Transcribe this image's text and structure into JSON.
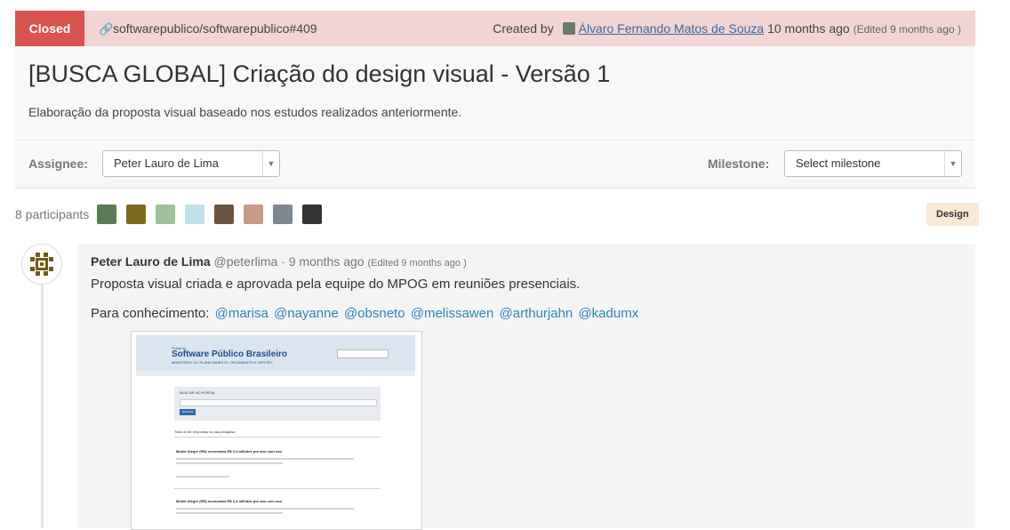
{
  "issue": {
    "state": "Closed",
    "reference": "softwarepublico/softwarepublico#409",
    "created_prefix": "Created by",
    "author": "Álvaro Fernando Matos de Souza",
    "created_ago": "10 months ago",
    "edited": "(Edited 9 months ago )",
    "title": "[BUSCA GLOBAL] Criação do design visual - Versão 1",
    "description": "Elaboração da proposta visual baseado nos estudos realizados anteriormente."
  },
  "meta": {
    "assignee_label": "Assignee:",
    "assignee_value": "Peter Lauro de Lima",
    "milestone_label": "Milestone:",
    "milestone_value": "Select milestone"
  },
  "participants": {
    "label": "8 participants",
    "avatars": [
      "#5a7a52",
      "#7d6a1e",
      "#9fc29a",
      "#bfe2ea",
      "#6b5540",
      "#c79a86",
      "#7f8790",
      "#333333"
    ]
  },
  "labels": [
    "Design"
  ],
  "note": {
    "author_name": "Peter Lauro de Lima",
    "author_handle": "@peterlima",
    "separator": "·",
    "time_ago": "9 months ago",
    "edited": "(Edited 9 months ago )",
    "text1": "Proposta visual criada e aprovada pela equipe do MPOG em reuniões presenciais.",
    "text2_prefix": "Para conhecimento:",
    "mentions": [
      "@marisa",
      "@nayanne",
      "@obsneto",
      "@melissawen",
      "@arthurjahn",
      "@kadumx"
    ]
  },
  "attachment": {
    "portal_label": "Portal do",
    "brand": "Software Público Brasileiro",
    "subtitle": "MINISTÉRIO DO PLANEJAMENTO, ORÇAMENTO E GESTÃO",
    "search_title": "BUSCAR NO PORTAL",
    "search_button": "BUSCAR",
    "results_header": "Total de 80 respostas na sua pesquisa",
    "result_titles": [
      "Monte Alegre (RN) economiza R$ 2,4 milhões por ano com uso",
      "Monte Alegre (RN) economiza R$ 2,4 milhões por ano com uso"
    ]
  },
  "colors": {
    "closed": "#d9534f",
    "issue_bar": "#f2d4d4",
    "link": "#3084bb",
    "label_design": "#fbe9d8"
  }
}
